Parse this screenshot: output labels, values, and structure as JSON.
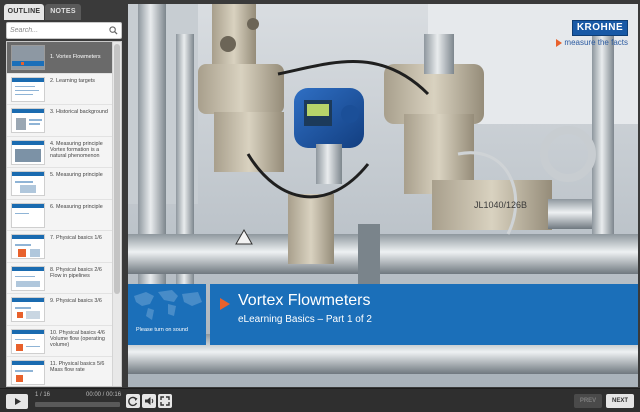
{
  "tabs": {
    "outline_label": "OUTLINE",
    "notes_label": "NOTES"
  },
  "search": {
    "placeholder": "Search..."
  },
  "outline": {
    "items": [
      {
        "label": "1. Vortex Flowmeters",
        "active": true
      },
      {
        "label": "2. Learning targets",
        "active": false
      },
      {
        "label": "3. Historical background",
        "active": false
      },
      {
        "label": "4. Measuring principle Vortex formation is a natural phenomenon",
        "active": false
      },
      {
        "label": "5. Measuring principle",
        "active": false
      },
      {
        "label": "6. Measuring principle",
        "active": false
      },
      {
        "label": "7. Physical basics 1/6",
        "active": false
      },
      {
        "label": "8. Physical basics 2/6 Flow in pipelines",
        "active": false
      },
      {
        "label": "9. Physical basics 3/6",
        "active": false
      },
      {
        "label": "10. Physical basics 4/6 Volume flow (operating volume)",
        "active": false
      },
      {
        "label": "11. Physical basics 5/6 Mass flow rate",
        "active": false
      }
    ]
  },
  "slide": {
    "brand": "KROHNE",
    "tagline": "measure the facts",
    "title": "Vortex Flowmeters",
    "subtitle": "eLearning Basics – Part 1 of 2",
    "sound_note": "Please turn on sound"
  },
  "player": {
    "slide_counter": "1 / 16",
    "time": "00:00 / 00:16",
    "progress": 0.0,
    "prev_label": "PREV",
    "next_label": "NEXT"
  },
  "colors": {
    "accent_blue": "#1b6fb9",
    "accent_orange": "#e8612c",
    "brand_blue": "#1859a6"
  }
}
